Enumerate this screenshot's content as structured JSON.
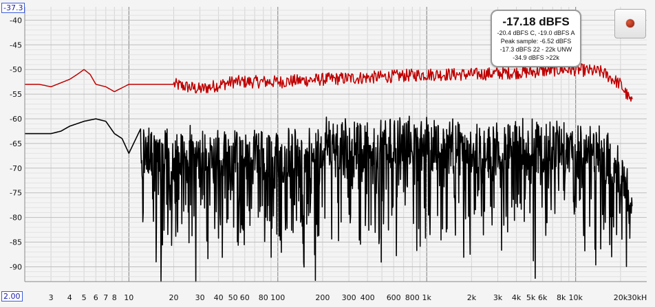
{
  "window": {
    "kind": "spectrum-analyzer"
  },
  "readout": {
    "level": "-17.18 dBFS",
    "weighted": "-20.4 dBFS C, -19.0 dBFS A",
    "peak": "Peak sample: -6.52 dBFS",
    "band": "-17.3 dBFS 22 - 22k UNW",
    "above": "-34.9 dBFS >22k"
  },
  "y_ref_box": "-37.3",
  "x_ref_box": "2.00",
  "record_button": {
    "icon": "record-dot-icon"
  },
  "colors": {
    "peak_trace": "#c00000",
    "live_trace": "#000000",
    "grid": "#d4d4d4",
    "background": "#f4f4f4"
  },
  "chart_data": {
    "type": "line",
    "x_scale": "log",
    "xlim": [
      2,
      30000
    ],
    "ylim": [
      -93,
      -37.3
    ],
    "x_tick_values": [
      3,
      4,
      5,
      6,
      7,
      8,
      10,
      20,
      30,
      40,
      50,
      60,
      80,
      100,
      200,
      300,
      400,
      600,
      800,
      1000,
      2000,
      3000,
      4000,
      5000,
      6000,
      8000,
      10000,
      20000,
      30000
    ],
    "x_tick_labels": [
      "3",
      "4",
      "5",
      "6",
      "7",
      "8",
      "10",
      "20",
      "30",
      "40",
      "50",
      "60",
      "80",
      "100",
      "200",
      "300",
      "400",
      "600",
      "800",
      "1k",
      "2k",
      "3k",
      "4k",
      "5k",
      "6k",
      "8k",
      "10k",
      "20k",
      "30kH"
    ],
    "y_tick_values": [
      -40,
      -45,
      -50,
      -55,
      -60,
      -65,
      -70,
      -75,
      -80,
      -85,
      -90
    ],
    "y_tick_labels": [
      "-40",
      "-45",
      "-50",
      "-55",
      "-60",
      "-65",
      "-70",
      "-75",
      "-80",
      "-85",
      "-90"
    ],
    "grid": true,
    "series": [
      {
        "role": "peak hold",
        "color": "#c00000",
        "x": [
          2,
          2.5,
          3,
          4,
          4.5,
          5,
          5.5,
          6,
          7,
          8,
          10,
          15,
          20,
          30,
          50,
          100,
          200,
          500,
          1000,
          2000,
          5000,
          8000,
          10000,
          15000,
          20000,
          24000
        ],
        "y": [
          -53,
          -53,
          -53.5,
          -52,
          -51,
          -50,
          -51,
          -53,
          -53.5,
          -54.5,
          -53,
          -53,
          -53,
          -54,
          -52.5,
          -52.5,
          -52,
          -51.5,
          -51,
          -51,
          -50.5,
          -50,
          -50,
          -50.5,
          -53,
          -57
        ]
      },
      {
        "role": "live spectrum",
        "color": "#000000",
        "x": [
          2,
          2.5,
          3,
          3.5,
          4,
          5,
          6,
          7,
          8,
          9,
          10,
          12,
          15,
          20,
          25,
          30,
          40,
          50,
          70,
          100,
          200,
          500,
          1000,
          2000,
          5000,
          10000,
          15000,
          20000,
          24000
        ],
        "y": [
          -63,
          -63,
          -63,
          -62.5,
          -61.5,
          -60.5,
          -60,
          -60.5,
          -63,
          -64,
          -67,
          -62,
          -62.5,
          -62,
          -61.5,
          -63,
          -62,
          -62.5,
          -62,
          -62,
          -60.5,
          -60,
          -60,
          -61,
          -60.5,
          -61,
          -62,
          -65,
          -70
        ]
      }
    ]
  }
}
